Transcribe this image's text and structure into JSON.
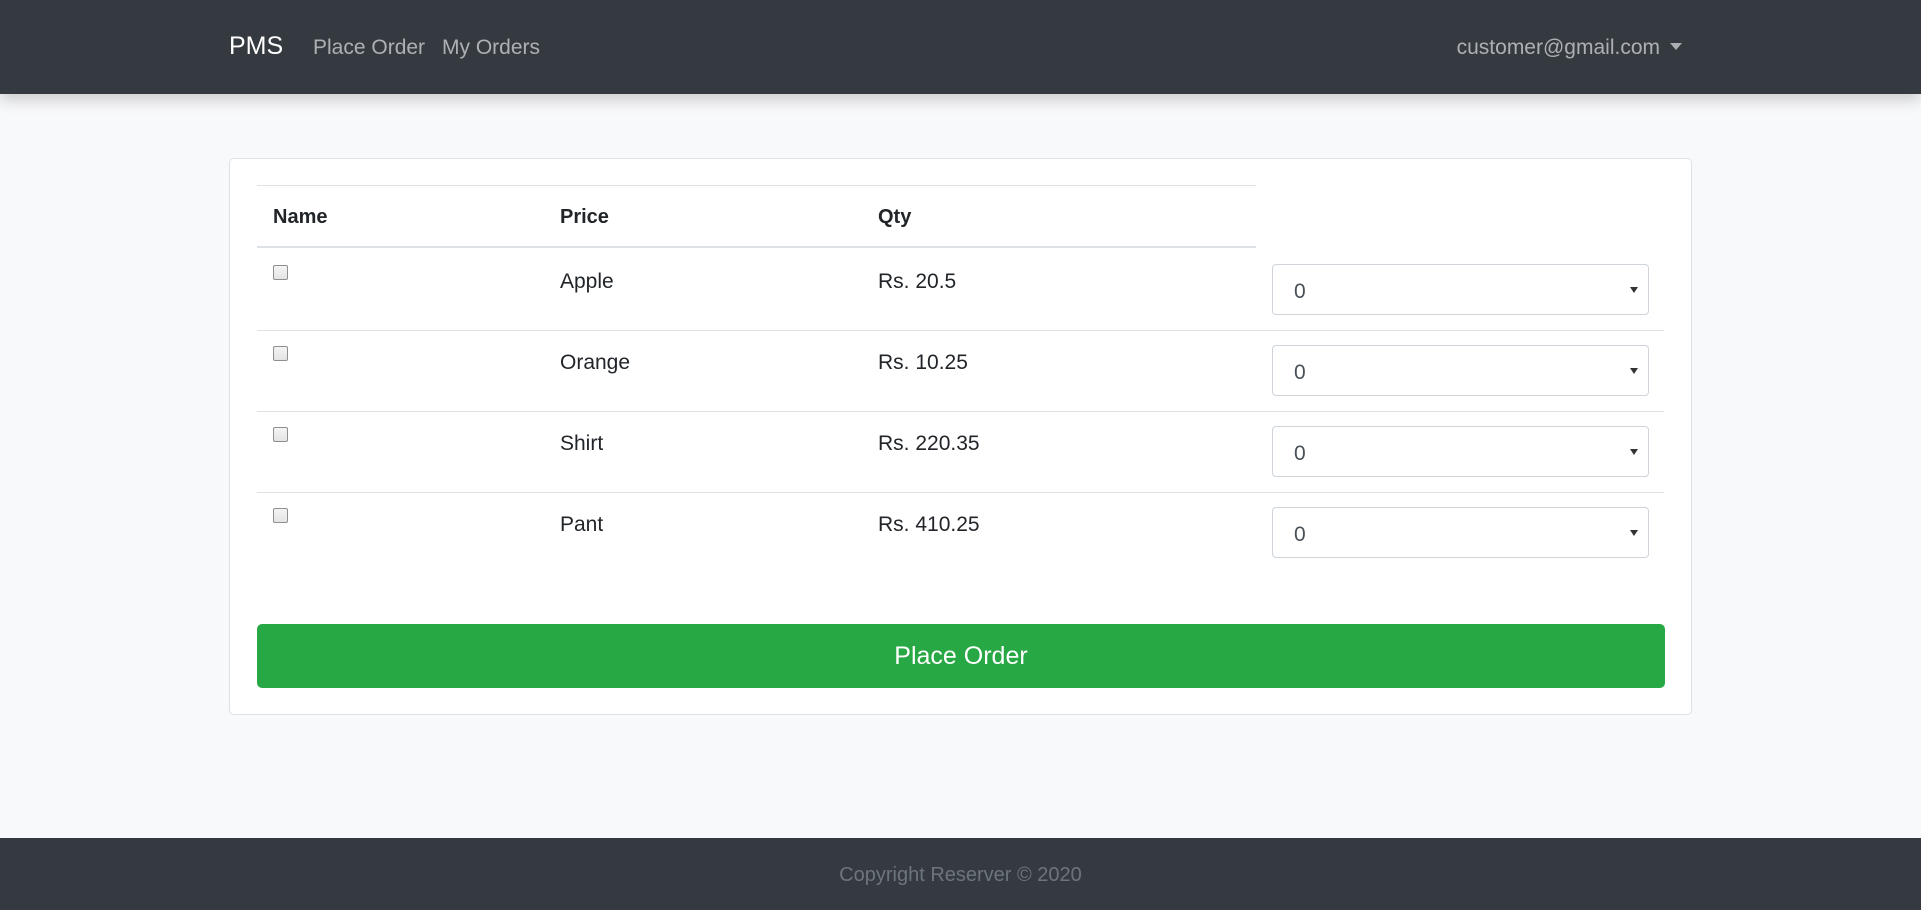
{
  "navbar": {
    "brand": "PMS",
    "links": [
      "Place Order",
      "My Orders"
    ],
    "user": "customer@gmail.com"
  },
  "table": {
    "headers": [
      "Name",
      "Price",
      "Qty"
    ],
    "rows": [
      {
        "name": "Apple",
        "price": "Rs. 20.5",
        "qty": "0",
        "checked": false
      },
      {
        "name": "Orange",
        "price": "Rs. 10.25",
        "qty": "0",
        "checked": false
      },
      {
        "name": "Shirt",
        "price": "Rs. 220.35",
        "qty": "0",
        "checked": false
      },
      {
        "name": "Pant",
        "price": "Rs. 410.25",
        "qty": "0",
        "checked": false
      }
    ]
  },
  "submit_label": "Place Order",
  "footer": {
    "text": "Copyright Reserver © 2020"
  },
  "colors": {
    "navbar_bg": "#343a40",
    "page_bg": "#f8f9fa",
    "button_green": "#28a745",
    "footer_bg": "#343a40"
  },
  "icons": {
    "user_menu": "caret-down-icon",
    "select": "chevron-down-icon"
  }
}
